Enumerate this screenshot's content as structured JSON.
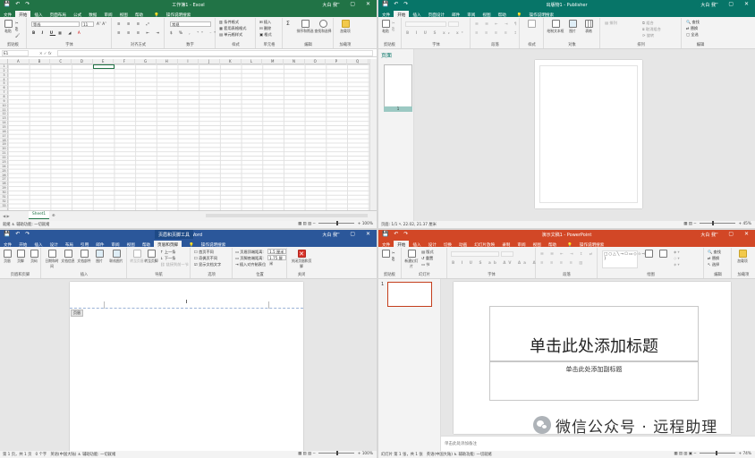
{
  "excel": {
    "title": "工作簿1 - Excel",
    "user": "大白 我",
    "tabs": [
      "文件",
      "开始",
      "插入",
      "页面布局",
      "公式",
      "数据",
      "审阅",
      "视图",
      "帮助",
      "操作说明搜索"
    ],
    "active_tab": "开始",
    "groups": [
      "剪贴板",
      "字体",
      "对齐方式",
      "数字",
      "样式",
      "单元格",
      "编辑",
      "加载项"
    ],
    "paste_label": "粘贴",
    "font_name": "等线",
    "font_size": "11",
    "number_format": "常规",
    "style_items": [
      "条件格式",
      "套用表格格式",
      "单元格样式"
    ],
    "cell_items": [
      "插入",
      "删除",
      "格式"
    ],
    "edit_items": [
      "排序和筛选",
      "查找和选择"
    ],
    "addin_label": "加载项",
    "name_box": "E1",
    "fx": "fx",
    "columns": [
      "A",
      "B",
      "C",
      "D",
      "E",
      "F",
      "G",
      "H",
      "I",
      "J",
      "K",
      "L",
      "M",
      "N",
      "O",
      "P",
      "Q"
    ],
    "rows": [
      "1",
      "2",
      "3",
      "4",
      "5",
      "6",
      "7",
      "8",
      "9",
      "10",
      "11",
      "12",
      "13",
      "14",
      "15",
      "16",
      "17",
      "18",
      "19",
      "20",
      "21",
      "22",
      "23",
      "24",
      "25",
      "26",
      "27",
      "28",
      "29",
      "30",
      "31",
      "32",
      "33"
    ],
    "sheet_tab": "Sheet1",
    "status_left": "就绪",
    "status_access": "辅助功能: 一切就绪",
    "zoom": "100%"
  },
  "publisher": {
    "title": "出版物1 - Publisher",
    "user": "大白 我",
    "tabs": [
      "文件",
      "开始",
      "插入",
      "页面设计",
      "邮件",
      "审阅",
      "视图",
      "帮助",
      "操作说明搜索"
    ],
    "active_tab": "开始",
    "groups": [
      "剪贴板",
      "字体",
      "段落",
      "样式",
      "对象",
      "排列",
      "编辑"
    ],
    "paste_label": "粘贴",
    "object_items": [
      "绘制文本框",
      "图片",
      "表格"
    ],
    "arrange_items": [
      "排列",
      "组合",
      "取消组合",
      "旋转"
    ],
    "edit_items": [
      "查找",
      "替换",
      "全选"
    ],
    "pages_pane_title": "页面",
    "page_number": "1",
    "status_page": "页面: 1/1",
    "status_pos": "22.02, 21.37 厘米",
    "zoom": "45%"
  },
  "word": {
    "title": "文档1 - Word",
    "context_title": "页眉和页脚工具",
    "user": "大白 我",
    "tabs": [
      "文件",
      "开始",
      "插入",
      "设计",
      "布局",
      "引用",
      "邮件",
      "审阅",
      "视图",
      "帮助",
      "页眉和页脚",
      "操作说明搜索"
    ],
    "active_tab": "页眉和页脚",
    "groups": [
      "页眉和页脚",
      "插入",
      "导航",
      "选项",
      "位置",
      "关闭"
    ],
    "hf_buttons": [
      "页眉",
      "页脚",
      "页码"
    ],
    "insert_buttons": [
      "日期和时间",
      "文档信息",
      "文档部件",
      "图片",
      "联机图片"
    ],
    "nav_buttons": [
      "转至页眉",
      "转至页脚",
      "上一条",
      "下一条",
      "链接到前一节"
    ],
    "option_items": [
      "首页不同",
      "奇偶页不同",
      "显示文档文字"
    ],
    "position_items": [
      "页眉顶端距离:",
      "页脚底端距离:",
      "插入对齐制表位"
    ],
    "header_distance": "1.5 厘米",
    "footer_distance": "1.75 厘米",
    "close_label": "关闭页眉和页脚",
    "header_tag": "页眉",
    "status_page": "第 1 页，共 1 页",
    "status_words": "0 个字",
    "status_lang": "英语(中国大陆)",
    "status_access": "辅助功能: 一切就绪",
    "zoom": "100%"
  },
  "powerpoint": {
    "title": "演示文稿1 - PowerPoint",
    "user": "大白 我",
    "tabs": [
      "文件",
      "开始",
      "插入",
      "设计",
      "切换",
      "动画",
      "幻灯片放映",
      "录制",
      "审阅",
      "视图",
      "帮助",
      "操作说明搜索"
    ],
    "active_tab": "开始",
    "groups": [
      "剪贴板",
      "幻灯片",
      "字体",
      "段落",
      "绘图",
      "编辑",
      "加载项"
    ],
    "slide_buttons": [
      "新建幻灯片",
      "版式",
      "重置",
      "节"
    ],
    "edit_items": [
      "查找",
      "替换",
      "选择"
    ],
    "addin_label": "加载项",
    "slide_number": "1",
    "slide_title": "单击此处添加标题",
    "slide_subtitle": "单击此处添加副标题",
    "notes_placeholder": "单击此处添加备注",
    "status_slide": "幻灯片 第 1 张，共 1 张",
    "status_lang": "英语(中国大陆)",
    "status_access": "辅助功能: 一切就绪",
    "zoom": "74%"
  },
  "watermark": "微信公众号 · 远程助理",
  "colors": {
    "excel": "#217346",
    "publisher": "#077568",
    "word": "#2b579a",
    "powerpoint": "#d24726"
  }
}
